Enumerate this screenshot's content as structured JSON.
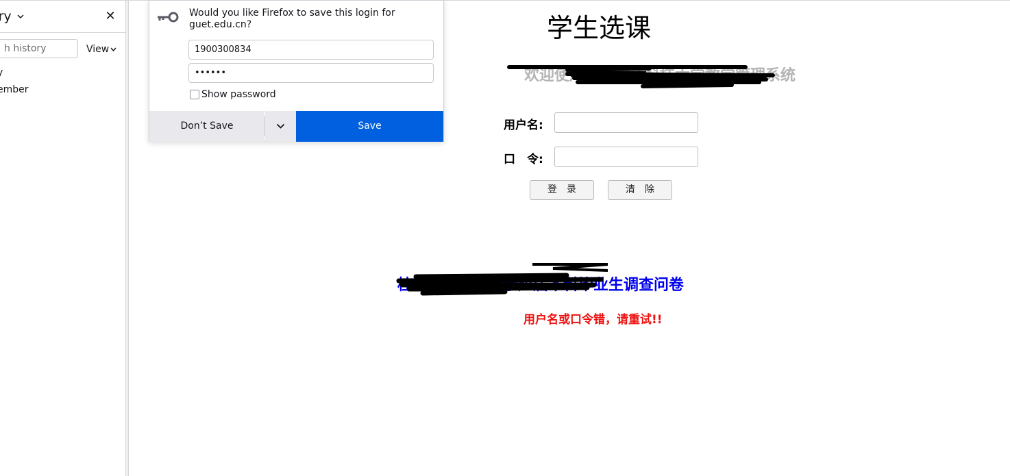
{
  "sidebar": {
    "title": "ory",
    "search_placeholder": "h history",
    "view_label": "View",
    "items": [
      {
        "label": "y"
      },
      {
        "label": "ember"
      }
    ]
  },
  "popup": {
    "message": "Would you like Firefox to save this login for guet.edu.cn?",
    "username_value": "1900300834",
    "password_value": "••••••",
    "show_password_label": "Show password",
    "dont_save_label": "Don’t Save",
    "save_label": "Save"
  },
  "page": {
    "title": "学生选课",
    "welcome": "欢迎使用桂林电子科技大学教学管理系统",
    "username_label": "用户名:",
    "password_label": "口　令:",
    "login_button": "登　录",
    "clear_button": "清　除",
    "survey_link": "桂林电子科技大学应届本科毕业生调查问卷",
    "error_message": "用户名或口令错，请重试!!"
  },
  "colors": {
    "save_button": "#0060df",
    "link": "#0000ee",
    "error": "#ee1111",
    "welcome": "#b4b4b4"
  }
}
